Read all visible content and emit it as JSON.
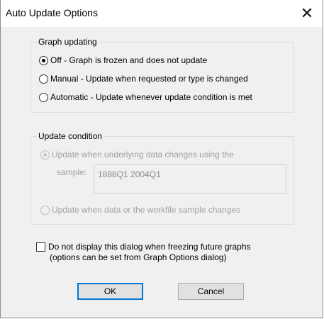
{
  "window": {
    "title": "Auto Update Options",
    "close_glyph": "✕"
  },
  "graph_updating": {
    "legend": "Graph updating",
    "options": [
      {
        "label": "Off - Graph is frozen and does not update",
        "selected": true
      },
      {
        "label": "Manual - Update when requested or type is changed",
        "selected": false
      },
      {
        "label": "Automatic - Update whenever update condition is met",
        "selected": false
      }
    ]
  },
  "update_condition": {
    "legend": "Update condition",
    "enabled": false,
    "option_data_changes": "Update when underlying data changes using the",
    "sample_label": "sample:",
    "sample_value": "1888Q1 2004Q1",
    "option_sample_changes": "Update when data or the workfile sample changes"
  },
  "dont_show": {
    "checked": false,
    "line1": "Do not display this dialog when freezing future graphs",
    "line2": "(options can be set from Graph Options dialog)"
  },
  "buttons": {
    "ok": "OK",
    "cancel": "Cancel"
  },
  "colors": {
    "dialog_bg": "#f0f0f0",
    "titlebar_bg": "#ffffff",
    "default_button_border": "#0078d7",
    "disabled_text": "#a0a0a0"
  }
}
